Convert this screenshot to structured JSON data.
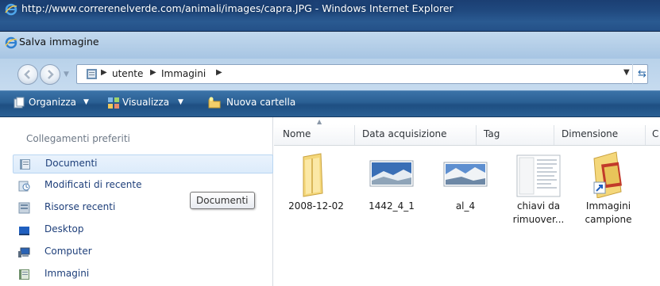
{
  "window": {
    "title": "http://www.correrenelverde.com/animali/images/capra.JPG - Windows Internet Explorer"
  },
  "dialog": {
    "title": "Salva immagine"
  },
  "address_bar": {
    "breadcrumbs": [
      "utente",
      "Immagini"
    ]
  },
  "toolbar": {
    "organize_label": "Organizza",
    "views_label": "Visualizza",
    "new_folder_label": "Nuova cartella"
  },
  "sidebar": {
    "header": "Collegamenti preferiti",
    "items": [
      {
        "label": "Documenti",
        "icon": "documents-icon"
      },
      {
        "label": "Modificati di recente",
        "icon": "recent-changed-icon"
      },
      {
        "label": "Risorse recenti",
        "icon": "recent-items-icon"
      },
      {
        "label": "Desktop",
        "icon": "desktop-icon"
      },
      {
        "label": "Computer",
        "icon": "computer-icon"
      },
      {
        "label": "Immagini",
        "icon": "pictures-icon"
      }
    ]
  },
  "tooltip": {
    "text": "Documenti"
  },
  "columns": [
    "Nome",
    "Data acquisizione",
    "Tag",
    "Dimensione",
    "C"
  ],
  "files": [
    {
      "name": "2008-12-02",
      "type": "folder"
    },
    {
      "name": "1442_4_1",
      "type": "image"
    },
    {
      "name": "al_4",
      "type": "image"
    },
    {
      "name_line1": "chiavi da",
      "name_line2": "rimuover...",
      "type": "document"
    },
    {
      "name_line1": "Immagini",
      "name_line2": "campione",
      "type": "shortcut-folder"
    }
  ],
  "colors": {
    "title_bar": "#20497f",
    "toolbar": "#2a5f93",
    "selection": "#dcebfb",
    "link_text": "#1e3f7a"
  }
}
